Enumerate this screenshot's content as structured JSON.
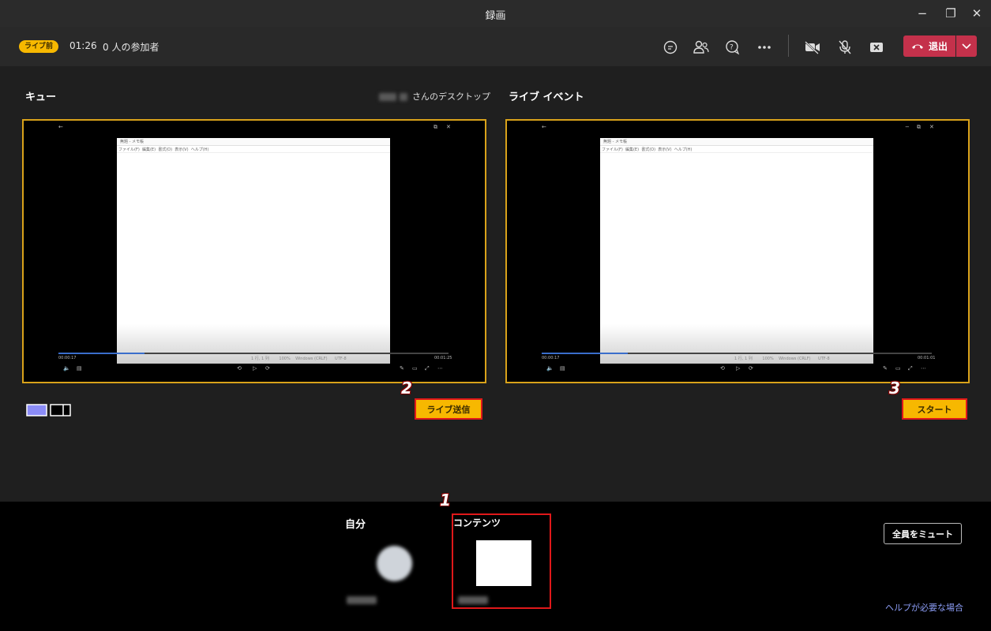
{
  "window": {
    "title": "録画",
    "minimize": "−",
    "maximize": "❐",
    "close": "✕"
  },
  "toolbar": {
    "badge": "ライブ前",
    "time": "01:26",
    "participants": "0 人の参加者",
    "icons": [
      "chat-icon",
      "people-icon",
      "qa-icon",
      "more-icon",
      "camera-off-icon",
      "mic-off-icon",
      "close-share-icon"
    ],
    "leave_label": "退出",
    "accent": "#c4314b"
  },
  "main": {
    "queue_label": "キュー",
    "desktop_suffix": "さんのデスクトップ",
    "live_label": "ライブ イベント",
    "send_live_label": "ライブ送信",
    "start_label": "スタート",
    "badges": [
      "1",
      "2",
      "3"
    ],
    "accent": "#f7b800"
  },
  "preview_left": {
    "app_title": "無題 - メモ帳",
    "menu": "ファイル(F)  編集(E)  書式(O)  表示(V)  ヘルプ(H)",
    "status": "1 行, 1 列        100%    Windows (CRLF)      UTF-8",
    "time_start": "00:00:17",
    "time_end": "00:01:25",
    "progress": 0.22
  },
  "preview_right": {
    "app_title": "無題 - メモ帳",
    "menu": "ファイル(F)  編集(E)  書式(O)  表示(V)  ヘルプ(H)",
    "status": "1 行, 1 列        100%    Windows (CRLF)      UTF-8",
    "time_start": "00:00:17",
    "time_end": "00:01:01",
    "progress": 0.22
  },
  "bottom": {
    "self_label": "自分",
    "content_label": "コンテンツ",
    "mute_all_label": "全員をミュート",
    "help_link": "ヘルプが必要な場合"
  }
}
